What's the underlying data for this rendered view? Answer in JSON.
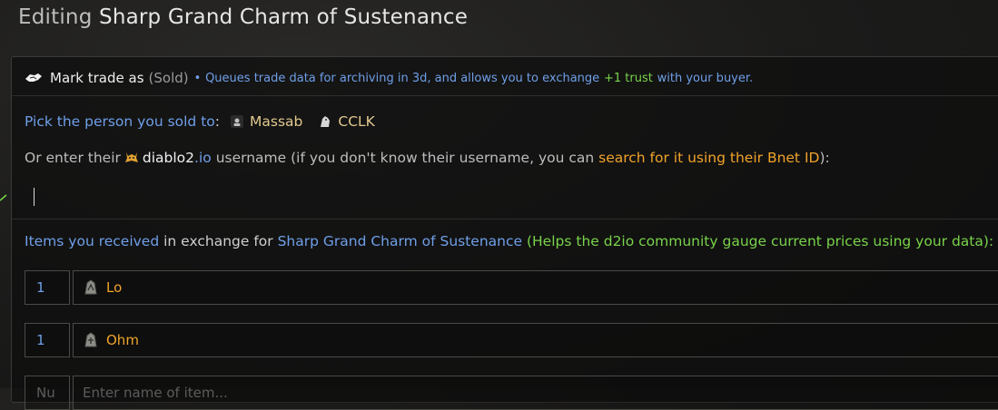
{
  "title": {
    "prefix": "Editing",
    "item": "Sharp Grand Charm of Sustenance"
  },
  "mark": {
    "icon": "handshake-icon",
    "label": "Mark trade as",
    "status": "(Sold)",
    "bullet": "•",
    "desc1": "Queues trade data for archiving in 3d, and allows you to exchange",
    "trust": "+1 trust",
    "desc2": "with your buyer."
  },
  "pick": {
    "label": "Pick the person you sold to",
    "colon": ":",
    "users": [
      {
        "name": "Massab",
        "icon": "user-avatar-icon"
      },
      {
        "name": "CCLK",
        "icon": "user-avatar-icon"
      }
    ]
  },
  "enter": {
    "pre": "Or enter their",
    "site_name": "diablo2",
    "site_tld": ".io",
    "mid": "username (if you don't know their username, you can",
    "link": "search for it using their Bnet ID",
    "post": "):"
  },
  "username_input": {
    "value": ""
  },
  "items": {
    "label1": "Items you received",
    "label2": "in exchange for",
    "item": "Sharp Grand Charm of Sustenance",
    "help": "(Helps the d2io community gauge current prices using your data):",
    "rows": [
      {
        "qty": "1",
        "name": "Lo",
        "icon": "rune-icon"
      },
      {
        "qty": "1",
        "name": "Ohm",
        "icon": "rune-icon"
      },
      {
        "qty": "Nu",
        "name": "Enter name of item...",
        "icon": ""
      }
    ]
  },
  "colors": {
    "blue": "#6f9fe8",
    "orange": "#f0a32a",
    "green": "#79d34a",
    "gold": "#e2c98e"
  }
}
